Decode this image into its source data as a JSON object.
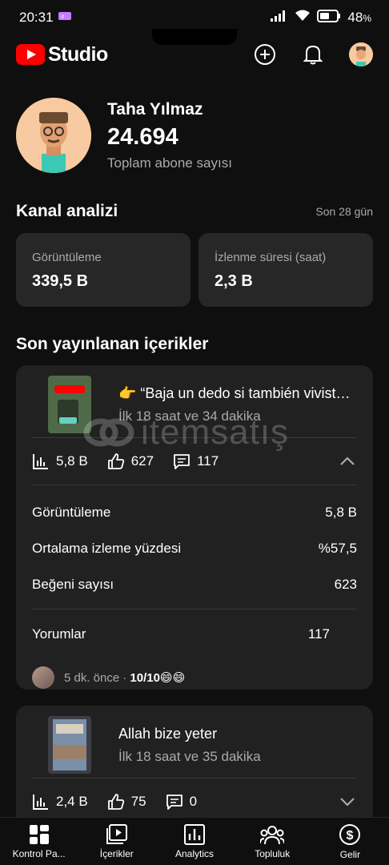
{
  "status_bar": {
    "time": "20:31",
    "battery": "48"
  },
  "header": {
    "logo_text": "Studio",
    "colors": {
      "brand": "#ff0000"
    }
  },
  "channel": {
    "name": "Taha Yılmaz",
    "subscribers": "24.694",
    "subscribers_label": "Toplam abone sayısı"
  },
  "analytics": {
    "title": "Kanal analizi",
    "period": "Son 28 gün",
    "cards": [
      {
        "label": "Görüntüleme",
        "value": "339,5 B"
      },
      {
        "label": "İzlenme süresi (saat)",
        "value": "2,3 B"
      }
    ]
  },
  "recent": {
    "title": "Son yayınlanan içerikler",
    "items": [
      {
        "title": "👉 “Baja un dedo si también viviste este momento",
        "age": "İlk 18 saat ve 34 dakika",
        "views": "5,8 B",
        "likes": "627",
        "comments": "117",
        "details": [
          {
            "label": "Görüntüleme",
            "value": "5,8 B"
          },
          {
            "label": "Ortalama izleme yüzdesi",
            "value": "%57,5"
          },
          {
            "label": "Beğeni sayısı",
            "value": "623"
          }
        ],
        "comments_label": "Yorumlar",
        "comments_count": "117",
        "latest_comment_time": "5 dk. önce ·",
        "latest_comment_text": "10/10😄😄"
      },
      {
        "title": "Allah bize yeter",
        "age": "İlk 18 saat ve 35 dakika",
        "views": "2,4 B",
        "likes": "75",
        "comments": "0"
      }
    ]
  },
  "watermark": {
    "text": "itemsatış"
  },
  "nav": [
    {
      "label": "Kontrol Pa...",
      "icon": "dashboard-icon"
    },
    {
      "label": "İçerikler",
      "icon": "content-icon"
    },
    {
      "label": "Analytics",
      "icon": "analytics-icon"
    },
    {
      "label": "Topluluk",
      "icon": "community-icon"
    },
    {
      "label": "Gelir",
      "icon": "earn-icon"
    }
  ]
}
